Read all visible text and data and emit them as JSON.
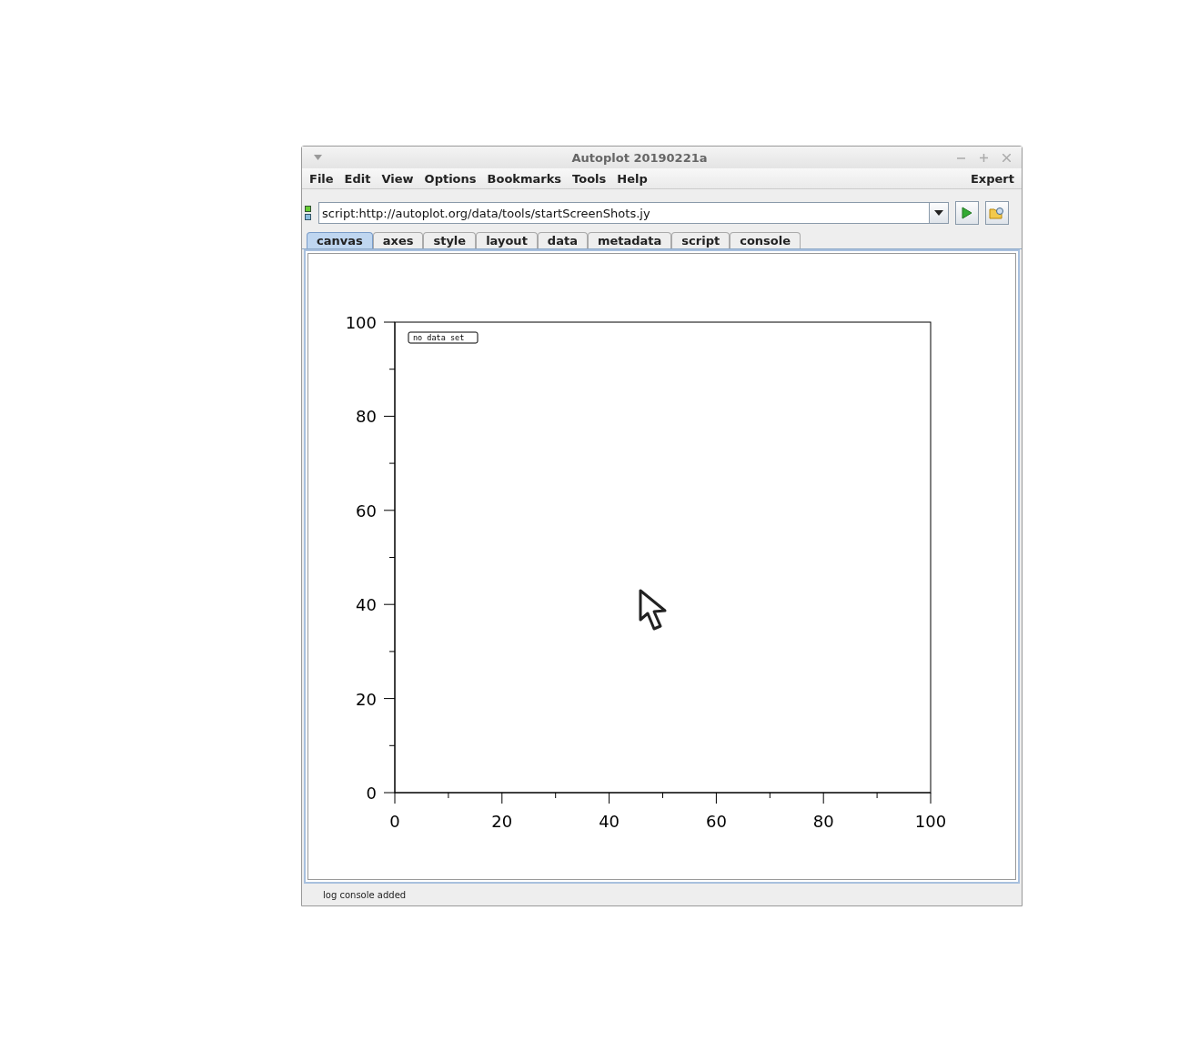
{
  "window": {
    "title": "Autoplot 20190221a"
  },
  "menu": [
    {
      "label": "File"
    },
    {
      "label": "Edit"
    },
    {
      "label": "View"
    },
    {
      "label": "Options"
    },
    {
      "label": "Bookmarks"
    },
    {
      "label": "Tools"
    },
    {
      "label": "Help"
    }
  ],
  "menu_right": "Expert",
  "address": {
    "value": "script:http://autoplot.org/data/tools/startScreenShots.jy"
  },
  "tabs": [
    {
      "label": "canvas",
      "selected": true
    },
    {
      "label": "axes",
      "selected": false
    },
    {
      "label": "style",
      "selected": false
    },
    {
      "label": "layout",
      "selected": false
    },
    {
      "label": "data",
      "selected": false
    },
    {
      "label": "metadata",
      "selected": false
    },
    {
      "label": "script",
      "selected": false
    },
    {
      "label": "console",
      "selected": false
    }
  ],
  "plot": {
    "chart_data": {
      "type": "line",
      "xlim": [
        0,
        100
      ],
      "ylim": [
        0,
        100
      ],
      "xticks": [
        0,
        20,
        40,
        60,
        80,
        100
      ],
      "yticks": [
        0,
        20,
        40,
        60,
        80,
        100
      ],
      "annotations": [
        "no data set"
      ]
    }
  },
  "status_bar": "log console added"
}
